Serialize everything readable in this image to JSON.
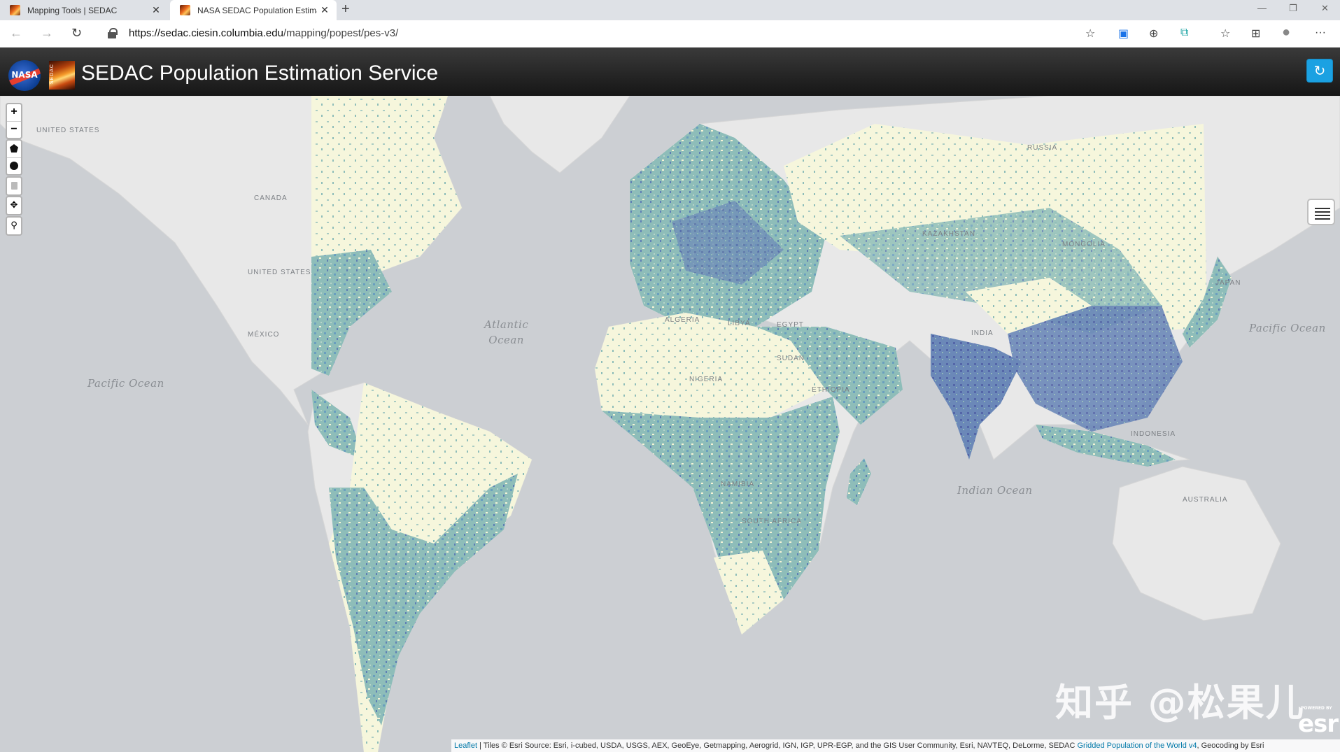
{
  "browser": {
    "tabs": [
      {
        "title": "Mapping Tools | SEDAC",
        "active": false
      },
      {
        "title": "NASA SEDAC Population Estimat",
        "active": true
      }
    ],
    "new_tab": "+",
    "url_host": "https://sedac.ciesin.columbia.edu",
    "url_path": "/mapping/popest/pes-v3/"
  },
  "app": {
    "nasa_logo_text": "NASA",
    "sedac_logo_text": "SEDAC",
    "title": "SEDAC Population Estimation Service",
    "refresh_icon": "↻"
  },
  "map": {
    "controls": {
      "zoom_in": "+",
      "zoom_out": "−"
    },
    "country_labels": {
      "us_north": "UNITED STATES",
      "canada": "CANADA",
      "us": "UNITED STATES",
      "mexico": "MÉXICO",
      "russia": "RUSSIA",
      "kazakhstan": "KAZAKHSTAN",
      "mongolia": "MONGOLIA",
      "japan": "JAPAN",
      "india": "INDIA",
      "algeria": "ALGERIA",
      "libya": "LIBYA",
      "egypt": "EGYPT",
      "sudan": "SUDAN",
      "nigeria": "NIGERIA",
      "ethiopia": "ETHIOPIA",
      "namibia": "NAMIBIA",
      "south_africa": "SOUTH AFRICA",
      "indonesia": "INDONESIA",
      "australia": "AUSTRALIA"
    },
    "ocean_labels": {
      "atlantic": "Atlantic\nOcean",
      "pacific_west": "Pacific Ocean",
      "pacific_east": "Pacific Ocean",
      "indian": "Indian Ocean"
    },
    "colors": {
      "water": "#cccfd3",
      "land": "#e9e9e9",
      "pop_low": "#f6f6dc",
      "pop_mid": "#7fb3b0",
      "pop_high": "#5f7fb4"
    }
  },
  "watermark": "知乎 @松果儿",
  "esri_logo": "esri",
  "esri_powered": "POWERED BY",
  "attribution": {
    "leaflet": "Leaflet",
    "text": " | Tiles © Esri Source: Esri, i-cubed, USDA, USGS, AEX, GeoEye, Getmapping, Aerogrid, IGN, IGP, UPR-EGP, and the GIS User Community, Esri, NAVTEQ, DeLorme, SEDAC ",
    "gpw_link": "Gridded Population of the World v4",
    "tail": ", Geocoding by Esri"
  }
}
